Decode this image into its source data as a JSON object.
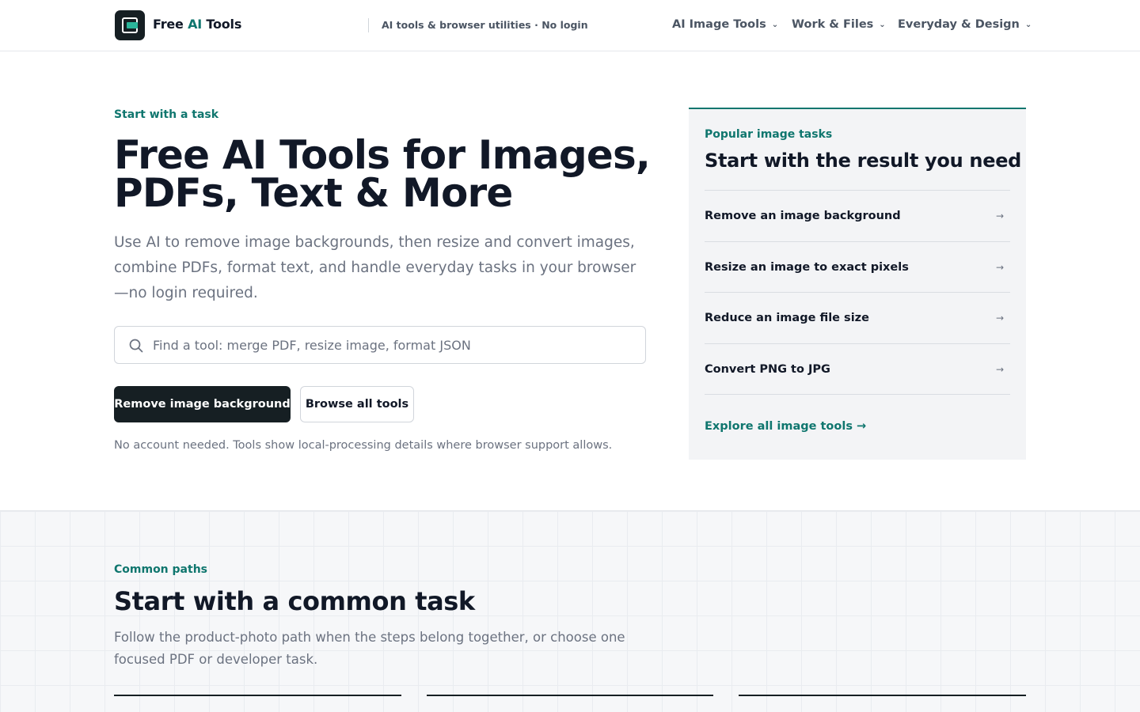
{
  "header": {
    "brand_prefix": "Free ",
    "brand_accent": "AI",
    "brand_suffix": " Tools",
    "tagline": "AI tools & browser utilities · No login",
    "nav": [
      {
        "label": "AI Image Tools"
      },
      {
        "label": "Work & Files"
      },
      {
        "label": "Everyday & Design"
      }
    ]
  },
  "hero": {
    "eyebrow": "Start with a task",
    "title": "Free AI Tools for Images, PDFs, Text & More",
    "description": "Use AI to remove image backgrounds, then resize and convert images, combine PDFs, format text, and handle everyday tasks in your browser—no login required.",
    "search_placeholder": "Find a tool: merge PDF, resize image, format JSON",
    "primary_button": "Remove image background",
    "secondary_button": "Browse all tools",
    "note": "No account needed. Tools show local-processing details where browser support allows."
  },
  "popular": {
    "eyebrow": "Popular image tasks",
    "title": "Start with the result you need",
    "items": [
      {
        "label": "Remove an image background",
        "arrow": "→"
      },
      {
        "label": "Resize an image to exact pixels",
        "arrow": "→"
      },
      {
        "label": "Reduce an image file size",
        "arrow": "→"
      },
      {
        "label": "Convert PNG to JPG",
        "arrow": "→"
      }
    ],
    "link": "Explore all image tools →"
  },
  "common": {
    "eyebrow": "Common paths",
    "title": "Start with a common task",
    "description": "Follow the product-photo path when the steps belong together, or choose one focused PDF or developer task."
  },
  "colors": {
    "accent": "#0f766e",
    "dark": "#161f23",
    "muted_text": "#6b7280"
  }
}
